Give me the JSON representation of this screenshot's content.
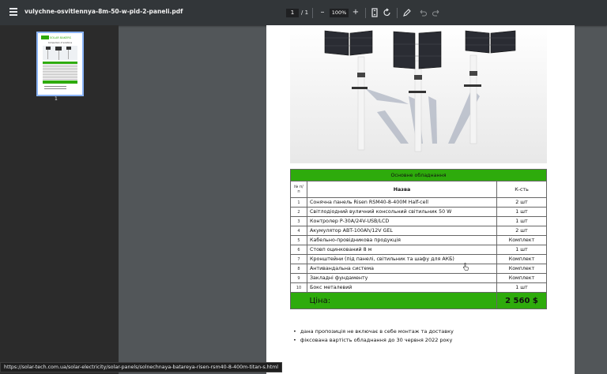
{
  "toolbar": {
    "title": "vulychne-osvitlennya-8m-50-w-pid-2-paneli.pdf",
    "current_page": "1",
    "page_separator": "/",
    "total_pages": "1",
    "zoom": "100%",
    "zoom_out_symbol": "–",
    "zoom_in_symbol": "+"
  },
  "sidebar": {
    "thumbnail_label": "1",
    "thumb_logo": "SOLAR BAKERS",
    "thumb_title": "Comparison of solutions"
  },
  "table": {
    "title": "Основне обладнання",
    "col_num": "№ п/п",
    "col_name": "Назва",
    "col_qty": "К-сть",
    "rows": [
      {
        "num": "1",
        "name": "Сонячна панель Risen RSM40-8-400M Half-cell",
        "qty": "2 шт"
      },
      {
        "num": "2",
        "name": "Світлодіодний вуличний консольний світильник 50 W",
        "qty": "1 шт"
      },
      {
        "num": "3",
        "name": "Контролер P-30A/24V-USB/LCD",
        "qty": "1 шт"
      },
      {
        "num": "4",
        "name": "Акумулятор ABT-100Ah/12V GEL",
        "qty": "2 шт"
      },
      {
        "num": "5",
        "name": "Кабельно-провідникова продукція",
        "qty": "Комплект"
      },
      {
        "num": "6",
        "name": "Стовп оцинкований 8 м",
        "qty": "1 шт"
      },
      {
        "num": "7",
        "name": "Кронштейни (під панелі, світильник та шафу для АКБ)",
        "qty": "Комплект"
      },
      {
        "num": "8",
        "name": "Антивандальна система",
        "qty": "Комплект"
      },
      {
        "num": "9",
        "name": "Закладні фундаменту",
        "qty": "Комплект"
      },
      {
        "num": "10",
        "name": "Бокс металевий",
        "qty": "1 шт"
      }
    ],
    "price_label": "Ціна:",
    "price_value": "2 560 $"
  },
  "notes": [
    "дана пропозиція не включає в себе монтаж та доставку",
    "фіксована вартість обладнання до 30 червня 2022 року"
  ],
  "status_url": "https://solar-tech.com.ua/solar-electricity/solar-panels/solnechnaya-batareya-risen-rsm40-8-400m-titan-s.html"
}
